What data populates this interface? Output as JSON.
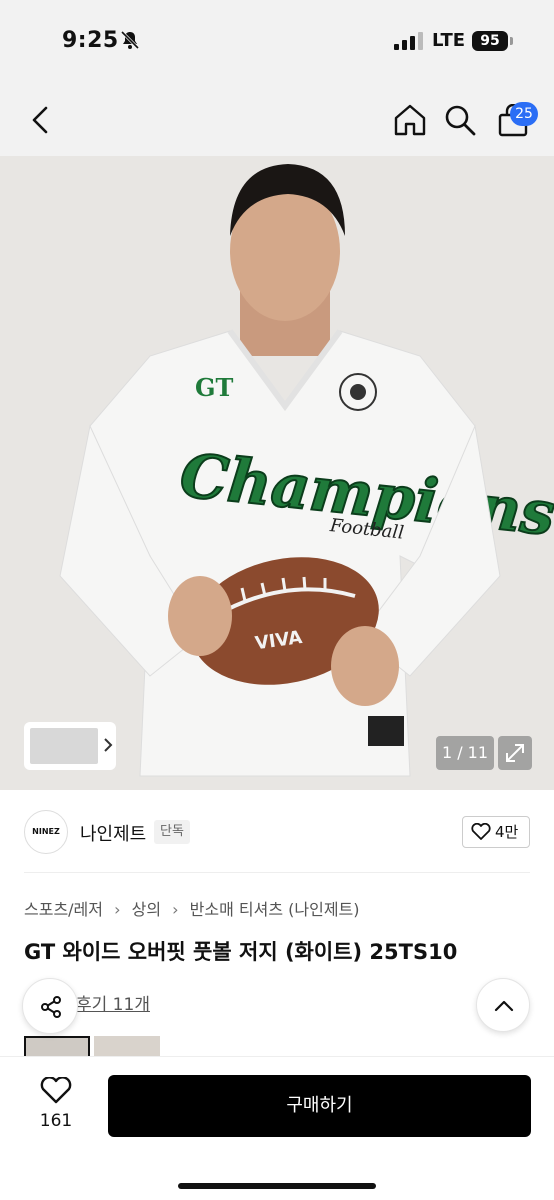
{
  "status": {
    "time": "9:25",
    "network": "LTE",
    "battery": "95"
  },
  "nav": {
    "cart_count": "25"
  },
  "hero": {
    "counter": "1 / 11",
    "jersey_text": "Champions",
    "jersey_sub": "Football",
    "jersey_badge": "GT",
    "ball_text": "VIVA"
  },
  "brand": {
    "logo_text": "NINEZ",
    "name": "나인제트",
    "tag": "단독",
    "likes": "4만"
  },
  "breadcrumb": [
    "스포츠/레저",
    "상의",
    "반소매 티셔츠 (나인제트)"
  ],
  "product": {
    "title": "GT 와이드 오버핏 풋볼 저지 (화이트) 25TS10",
    "reviews": "후기 11개"
  },
  "bottom": {
    "likes": "161",
    "buy_label": "구매하기"
  },
  "colors": {
    "accent": "#2b6ef5",
    "jersey_green": "#1f7a3a",
    "ball": "#8b4a2e"
  }
}
